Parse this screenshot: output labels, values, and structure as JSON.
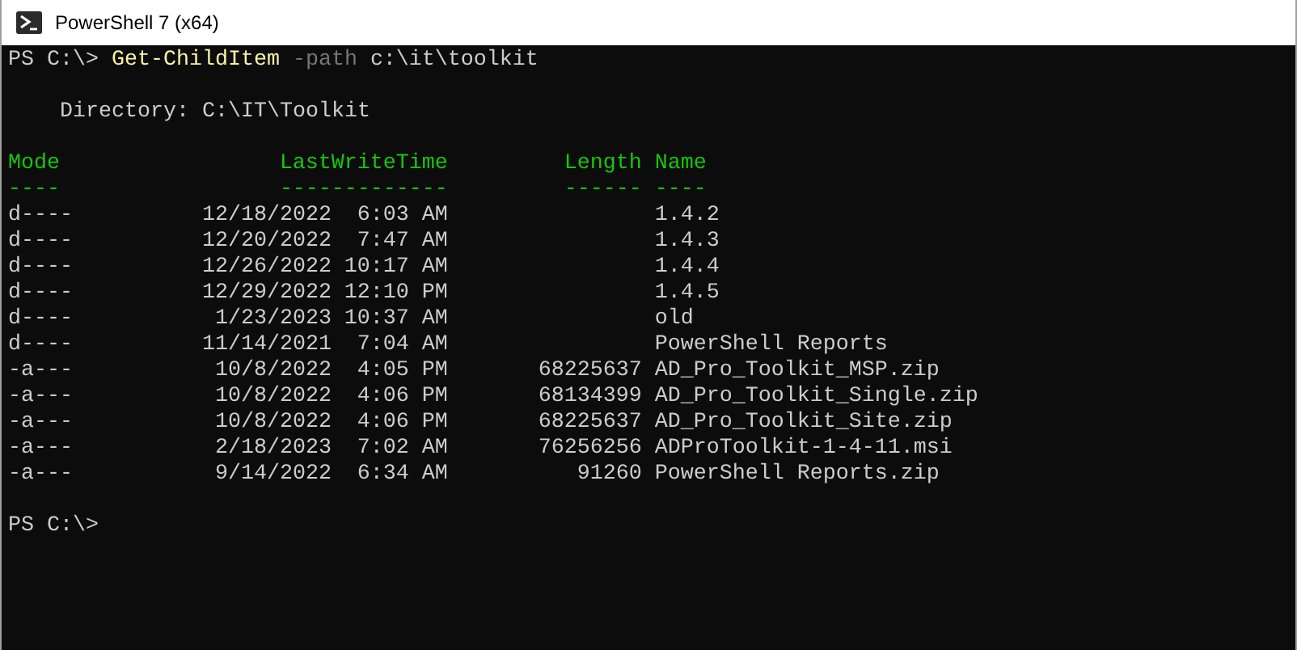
{
  "window": {
    "title": "PowerShell 7 (x64)"
  },
  "command": {
    "prompt": "PS C:\\>",
    "cmdlet": "Get-ChildItem",
    "parameter": "-path",
    "argument": "c:\\it\\toolkit"
  },
  "directory": "Directory: C:\\IT\\Toolkit",
  "columns": [
    {
      "header": "Mode",
      "underline": "----"
    },
    {
      "header": "LastWriteTime",
      "underline": "-------------"
    },
    {
      "header": "Length",
      "underline": "------"
    },
    {
      "header": "Name",
      "underline": "----"
    }
  ],
  "rows": [
    {
      "mode": "d----",
      "date": "12/18/2022",
      "time": "6:03 AM",
      "name": "1.4.2"
    },
    {
      "mode": "d----",
      "date": "12/20/2022",
      "time": "7:47 AM",
      "name": "1.4.3"
    },
    {
      "mode": "d----",
      "date": "12/26/2022",
      "time": "10:17 AM",
      "name": "1.4.4"
    },
    {
      "mode": "d----",
      "date": "12/29/2022",
      "time": "12:10 PM",
      "name": "1.4.5"
    },
    {
      "mode": "d----",
      "date": "1/23/2023",
      "time": "10:37 AM",
      "name": "old"
    },
    {
      "mode": "d----",
      "date": "11/14/2021",
      "time": "7:04 AM",
      "name": "PowerShell Reports"
    },
    {
      "mode": "-a---",
      "date": "10/8/2022",
      "time": "4:05 PM",
      "length": "68225637",
      "name": "AD_Pro_Toolkit_MSP.zip"
    },
    {
      "mode": "-a---",
      "date": "10/8/2022",
      "time": "4:06 PM",
      "length": "68134399",
      "name": "AD_Pro_Toolkit_Single.zip"
    },
    {
      "mode": "-a---",
      "date": "10/8/2022",
      "time": "4:06 PM",
      "length": "68225637",
      "name": "AD_Pro_Toolkit_Site.zip"
    },
    {
      "mode": "-a---",
      "date": "2/18/2023",
      "time": "7:02 AM",
      "length": "76256256",
      "name": "ADProToolkit-1-4-11.msi"
    },
    {
      "mode": "-a---",
      "date": "9/14/2022",
      "time": "6:34 AM",
      "length": "91260",
      "name": "PowerShell Reports.zip"
    }
  ],
  "final_prompt": "PS C:\\>"
}
